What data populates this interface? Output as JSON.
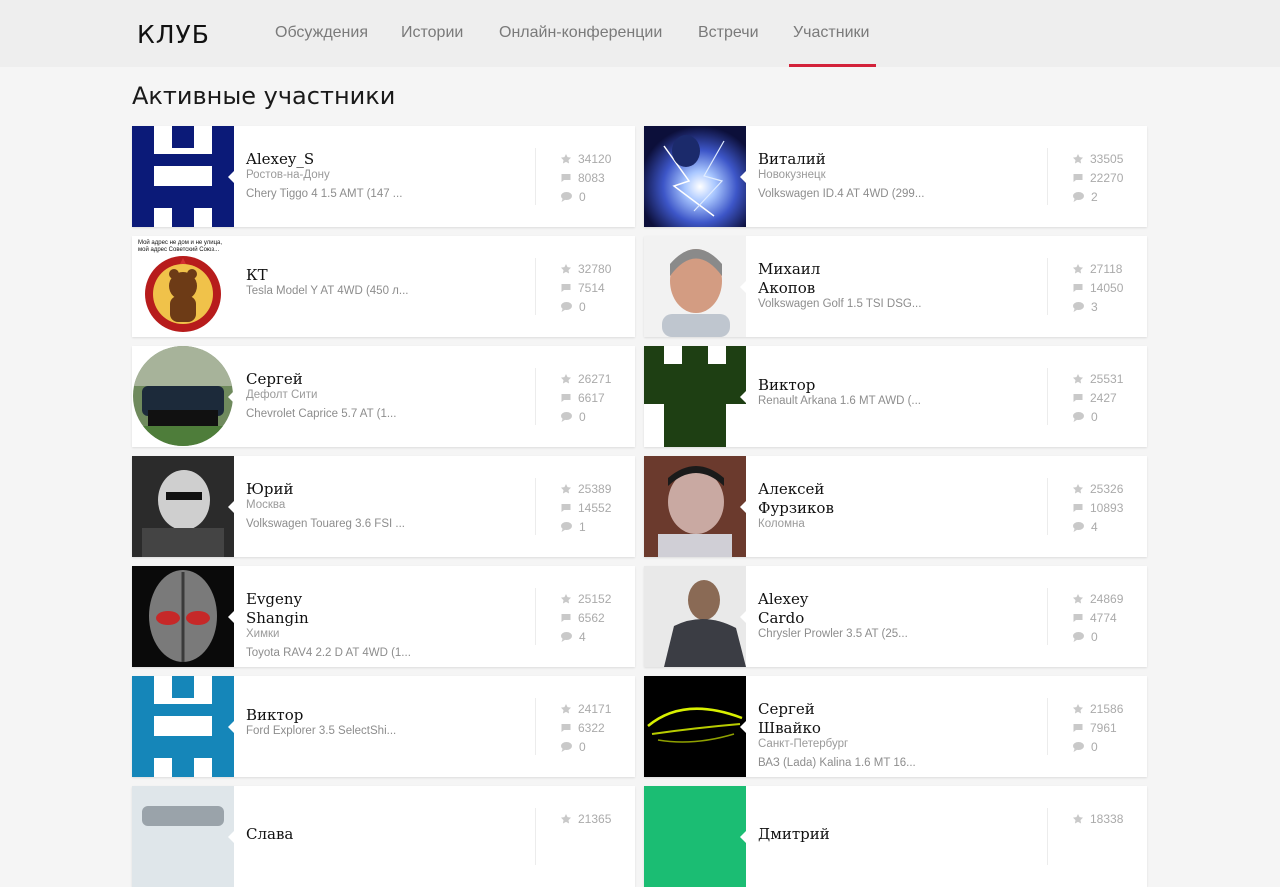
{
  "header": {
    "logo": "КЛУБ",
    "nav": [
      {
        "label": "Обсуждения"
      },
      {
        "label": "Истории"
      },
      {
        "label": "Онлайн-конференции"
      },
      {
        "label": "Встречи"
      },
      {
        "label": "Участники",
        "active": true
      }
    ],
    "accent_color": "#d3223a"
  },
  "page": {
    "title": "Активные участники"
  },
  "members": [
    {
      "name_lines": [
        "Alexey_S"
      ],
      "city": "Ростов-на-Дону",
      "car": "Chery Tiggo 4 1.5 AMT (147 ...",
      "rating": "34120",
      "posts": "8083",
      "comments": "0",
      "avatar": "blue-castle-logo"
    },
    {
      "name_lines": [
        "Виталий"
      ],
      "city": "Новокузнецк",
      "car": "Volkswagen ID.4 AT 4WD (299...",
      "rating": "33505",
      "posts": "22270",
      "comments": "2",
      "avatar": "lightning-figure"
    },
    {
      "name_lines": [
        "КТ"
      ],
      "city": "",
      "car": "Tesla Model Y AT 4WD (450 л...",
      "rating": "32780",
      "posts": "7514",
      "comments": "0",
      "avatar": "olympic-bear",
      "avatar_text": "Мой адрес не дом и не улица, мой адрес Советский Союз..."
    },
    {
      "name_lines": [
        "Михаил",
        "Акопов"
      ],
      "city": "",
      "car": "Volkswagen Golf 1.5 TSI DSG...",
      "rating": "27118",
      "posts": "14050",
      "comments": "3",
      "avatar": "man-portrait"
    },
    {
      "name_lines": [
        "Сергей"
      ],
      "city": "Дефолт Сити",
      "car": "Chevrolet Caprice 5.7 AT (1...",
      "rating": "26271",
      "posts": "6617",
      "comments": "0",
      "avatar": "car-photo"
    },
    {
      "name_lines": [
        "Виктор"
      ],
      "city": "",
      "car": "Renault Arkana 1.6 MT AWD (...",
      "rating": "25531",
      "posts": "2427",
      "comments": "0",
      "avatar": "green-castle-logo"
    },
    {
      "name_lines": [
        "Юрий"
      ],
      "city": "Москва",
      "car": "Volkswagen Touareg 3.6 FSI ...",
      "rating": "25389",
      "posts": "14552",
      "comments": "1",
      "avatar": "bw-portrait"
    },
    {
      "name_lines": [
        "Алексей",
        "Фурзиков"
      ],
      "city": "Коломна",
      "car": "",
      "rating": "25326",
      "posts": "10893",
      "comments": "4",
      "avatar": "man-selfie"
    },
    {
      "name_lines": [
        "Evgeny",
        "Shangin"
      ],
      "city": "Химки",
      "car": "Toyota RAV4 2.2 D AT 4WD (1...",
      "rating": "25152",
      "posts": "6562",
      "comments": "4",
      "avatar": "alien-head"
    },
    {
      "name_lines": [
        "Alexey",
        "Cardo"
      ],
      "city": "",
      "car": "Chrysler Prowler 3.5 AT (25...",
      "rating": "24869",
      "posts": "4774",
      "comments": "0",
      "avatar": "man-dark-shirt"
    },
    {
      "name_lines": [
        "Виктор"
      ],
      "city": "",
      "car": "Ford Explorer 3.5 SelectShi...",
      "rating": "24171",
      "posts": "6322",
      "comments": "0",
      "avatar": "cyan-castle-logo"
    },
    {
      "name_lines": [
        "Сергей",
        "Швайко"
      ],
      "city": "Санкт-Петербург",
      "car": "ВАЗ (Lada) Kalina 1.6 MT 16...",
      "rating": "21586",
      "posts": "7961",
      "comments": "0",
      "avatar": "concept-car-lines"
    },
    {
      "name_lines": [
        "Слава"
      ],
      "city": "",
      "car": "",
      "rating": "21365",
      "posts": "",
      "comments": "",
      "avatar": "car-photo-light"
    },
    {
      "name_lines": [
        "Дмитрий"
      ],
      "city": "",
      "car": "",
      "rating": "18338",
      "posts": "",
      "comments": "",
      "avatar": "green-castle-logo-light"
    }
  ]
}
